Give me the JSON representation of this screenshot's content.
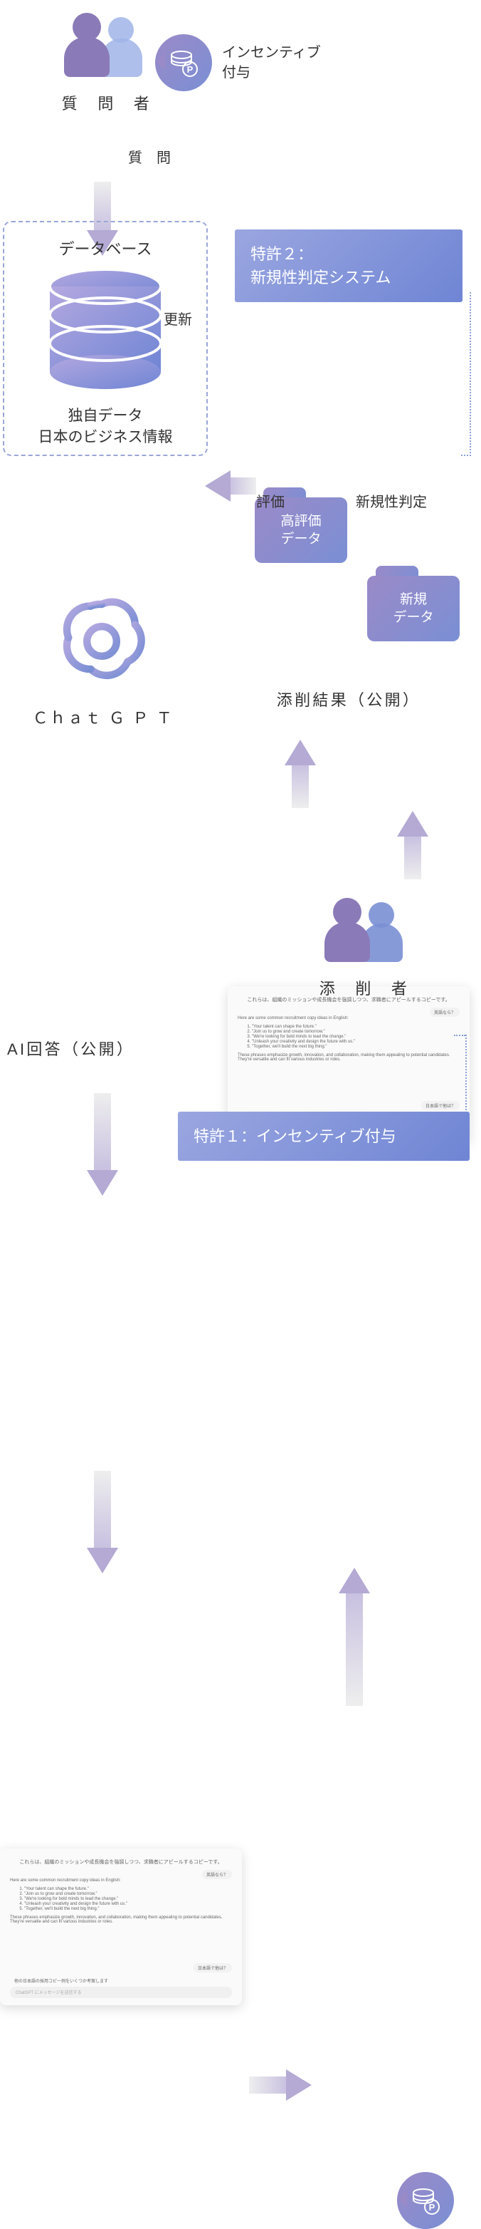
{
  "questioner": {
    "label": "質　問　者"
  },
  "incentive_bubble": {
    "text": "インセンティブ\n付与"
  },
  "arrow_question": {
    "label": "質　問"
  },
  "database_box": {
    "title": "データベース",
    "subtitle1": "独自データ",
    "subtitle2": "日本のビジネス情報"
  },
  "patent2": {
    "text": "特許２：\n新規性判定システム"
  },
  "arrow_update": {
    "label": "更新"
  },
  "folder_high": {
    "label": "高評価\nデータ"
  },
  "folder_new": {
    "label": "新規\nデータ"
  },
  "arrow_eval": {
    "label": "評価"
  },
  "arrow_novelty": {
    "label": "新規性判定"
  },
  "chatgpt": {
    "label": "Ｃｈａｔ Ｇ Ｐ Ｔ"
  },
  "review_result": {
    "label": "添削結果（公開）"
  },
  "ai_answer": {
    "label": "AI回答（公開）"
  },
  "reviewer": {
    "label": "添　削　者"
  },
  "patent1": {
    "text": "特許１：インセンティブ付与"
  },
  "mock": {
    "header_jp": "これらは、組織のミッションや成長機会を強調しつつ、求職者にアピールするコピーです。",
    "pill1": "英語なら？",
    "list_intro": "Here are some common recruitment copy ideas in English:",
    "items": [
      "\"Your talent can shape the future.\"",
      "\"Join us to grow and create tomorrow.\"",
      "\"We're looking for bold minds to lead the change.\"",
      "\"Unleash your creativity and design the future with us.\"",
      "\"Together, we'll build the next big thing.\""
    ],
    "footer": "These phrases emphasize growth, innovation, and collaboration, making them appealing to potential candidates. They're versatile and can fit various industries or roles.",
    "pill2": "日本語で他は？",
    "prompt_line": "他の日本語の採用コピー例をいくつか考案します",
    "input_placeholder": "ChatGPT にメッセージを送信する"
  }
}
